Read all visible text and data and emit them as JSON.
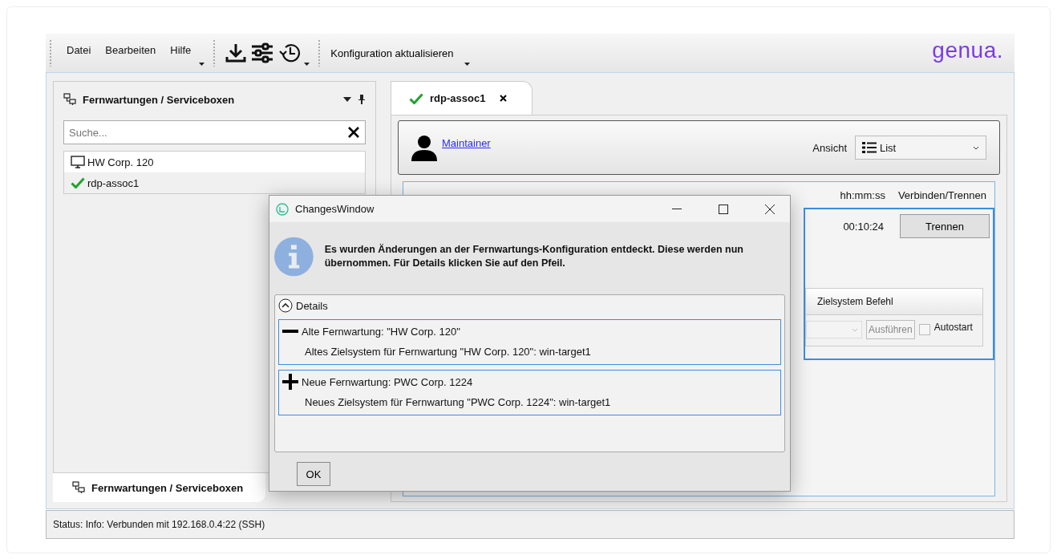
{
  "menu": [
    "Datei",
    "Bearbeiten",
    "Hilfe"
  ],
  "toolbar_button": "Konfiguration aktualisieren",
  "logo": "genua.",
  "left_panel": {
    "title": "Fernwartungen / Serviceboxen",
    "search": {
      "placeholder": "Suche..."
    },
    "items": [
      {
        "label": "HW Corp. 120",
        "kind": "computer",
        "selected": false
      },
      {
        "label": "rdp-assoc1",
        "kind": "connected",
        "selected": true
      }
    ],
    "bottom_tab": "Fernwartungen / Serviceboxen"
  },
  "session_tab": {
    "label": "rdp-assoc1",
    "connected": true
  },
  "user_link": "Maintainer",
  "view": {
    "label": "Ansicht",
    "value": "List"
  },
  "table": {
    "columns": [
      "hh:mm:ss",
      "Verbinden/Trennen"
    ],
    "row": {
      "time": "00:10:24",
      "button": "Trennen",
      "selected": true
    },
    "sub_header": "Zielsystem Befehl",
    "run_button": {
      "label": "Ausführen",
      "disabled": true
    },
    "autostart": {
      "label": "Autostart",
      "checked": false
    }
  },
  "dialog": {
    "title": "ChangesWindow",
    "message": "Es wurden Änderungen an der Fernwartungs-Konfiguration entdeckt. Diese werden nun übernommen. Für Details klicken Sie auf den Pfeil.",
    "details_label": "Details",
    "expanded": true,
    "changes": [
      {
        "kind": "removed",
        "title": "Alte Fernwartung: \"HW Corp. 120\"",
        "detail": "Altes Zielsystem für Fernwartung \"HW Corp. 120\": win-target1"
      },
      {
        "kind": "added",
        "title": "Neue Fernwartung: PWC Corp. 1224",
        "detail": "Neues Zielsystem für Fernwartung \"PWC Corp. 1224\": win-target1"
      }
    ],
    "ok": "OK"
  },
  "status_bar": "Status: Info: Verbunden mit 192.168.0.4:22 (SSH)"
}
